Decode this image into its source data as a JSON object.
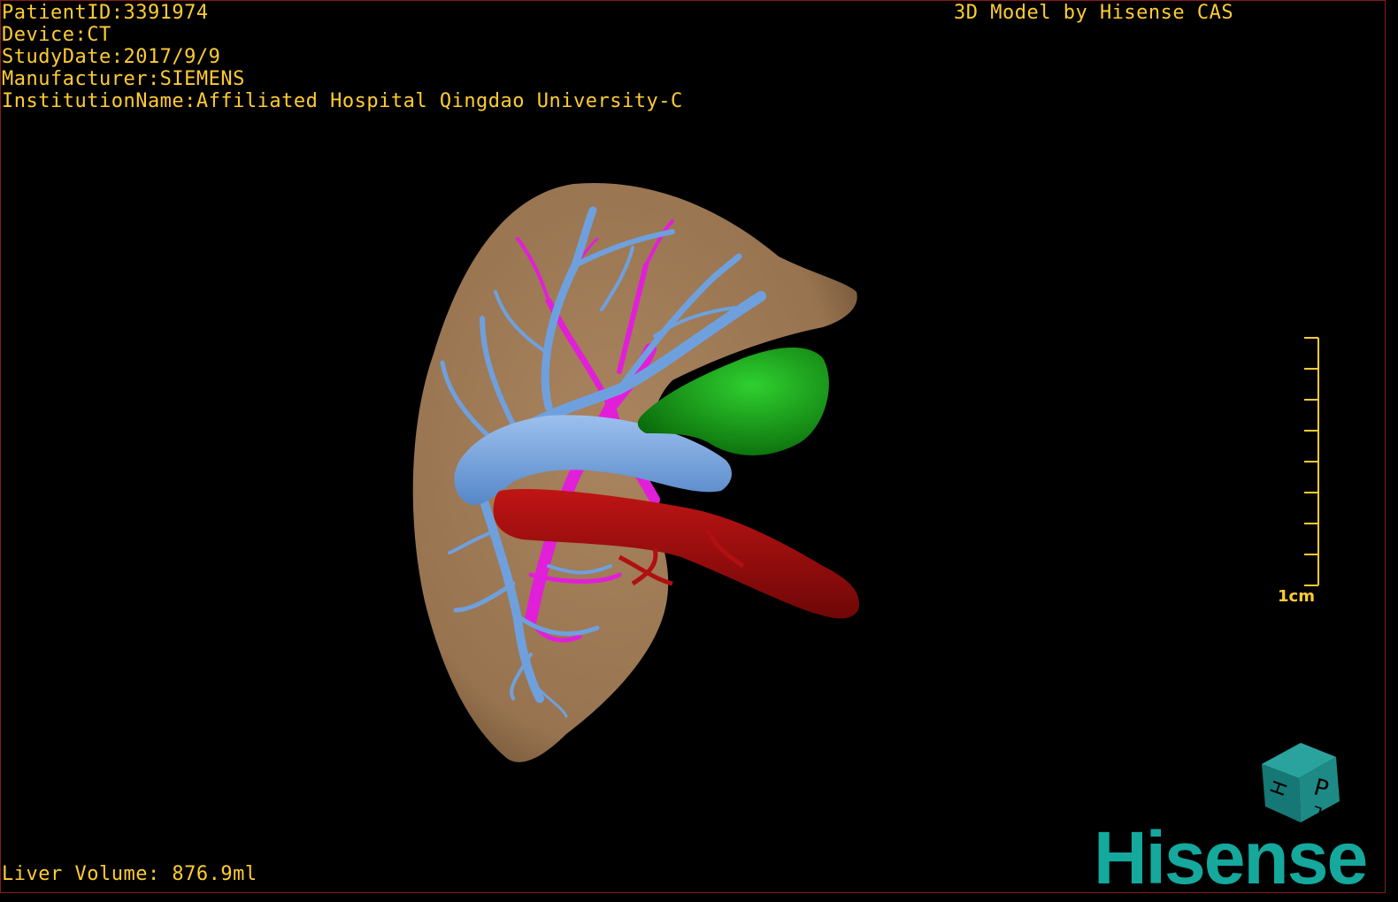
{
  "patient": {
    "id_line": "PatientID:3391974",
    "device_line": "Device:CT",
    "study_date_line": "StudyDate:2017/9/9",
    "manufacturer_line": "Manufacturer:SIEMENS",
    "institution_line": "InstitutionName:Affiliated Hospital Qingdao University-C"
  },
  "credit": "3D Model by Hisense CAS",
  "liver_volume": "Liver Volume: 876.9ml",
  "scale_bar": {
    "label": "1cm",
    "ticks": 9
  },
  "orientation_cube": {
    "faces": [
      "P",
      "H",
      "L"
    ],
    "color": "#1e8a86"
  },
  "logo": "Hisense",
  "colors": {
    "text": "#ffcc33",
    "liver": "#a17c58",
    "portal_vein": "#6fa0de",
    "hepatic_artery": "#e21fd8",
    "vena_cava": "#a80e0e",
    "gallbladder": "#1ea31e",
    "logo": "#15a89c"
  }
}
